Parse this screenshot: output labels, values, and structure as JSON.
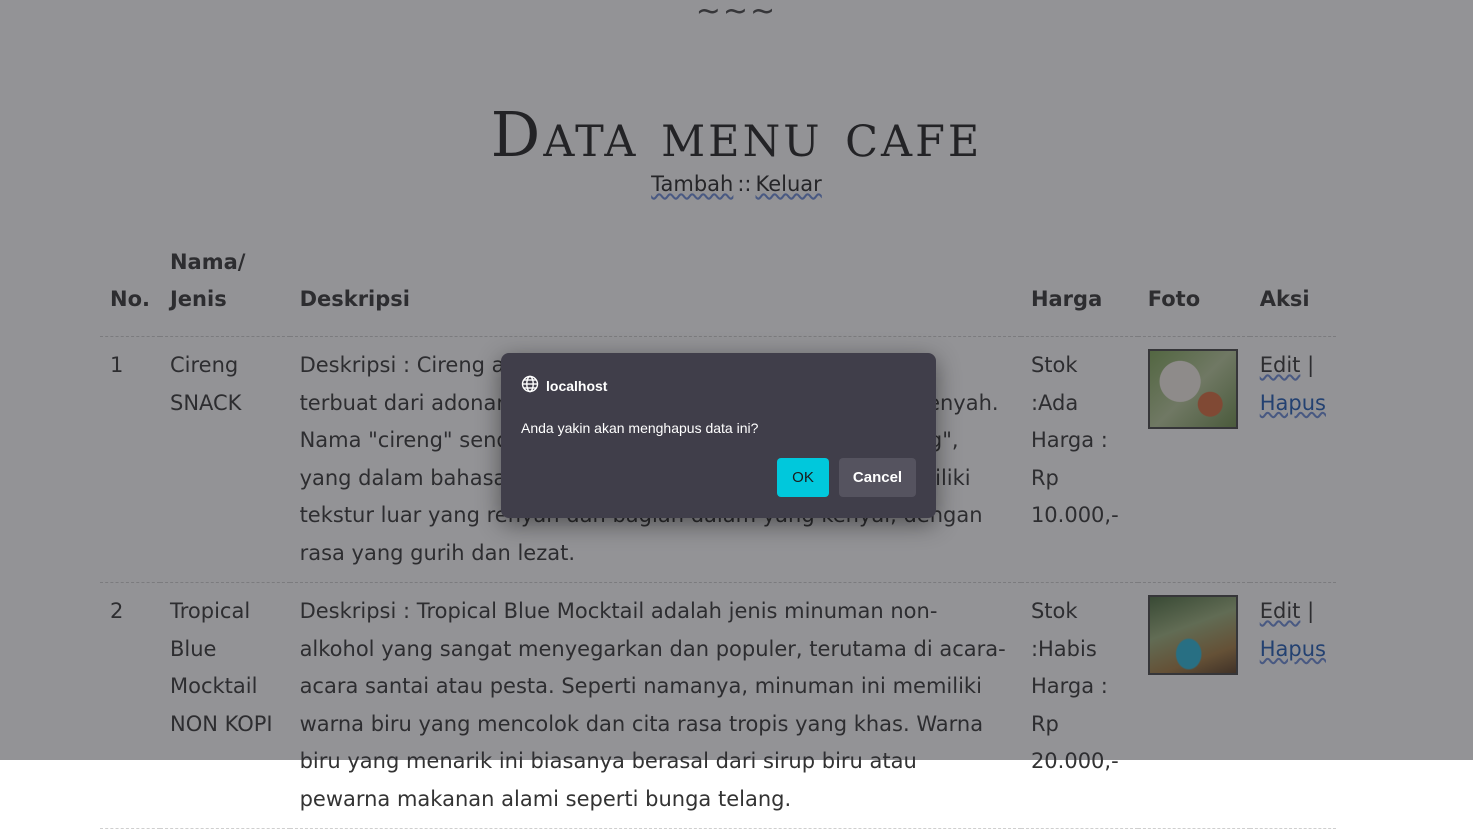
{
  "header": {
    "decoration": "~~~",
    "title": "Data menu cafe",
    "links": {
      "add": "Tambah",
      "separator": "::",
      "logout": "Keluar"
    }
  },
  "table": {
    "headers": {
      "no": "No.",
      "name": "Nama/ Jenis",
      "description": "Deskripsi",
      "price": "Harga",
      "photo": "Foto",
      "action": "Aksi"
    },
    "rows": [
      {
        "no": "1",
        "name": "Cireng",
        "type": "SNACK",
        "description": "Deskripsi : Cireng adalah makanan ringan khas Sunda yang terbuat dari adonan tepung tapioka yang digoreng hingga renyah. Nama \"cireng\" sendiri merupakan akronim dari \"aci digoreng\", yang dalam bahasa Sunda berarti aci digoreng. Cireng memiliki tekstur luar yang renyah dan bagian dalam yang kenyal, dengan rasa yang gurih dan lezat.",
        "stock": "Stok :Ada",
        "price": "Harga : Rp 10.000,-",
        "photo_icon": "cireng-photo",
        "edit": "Edit",
        "separator": "|",
        "delete": "Hapus"
      },
      {
        "no": "2",
        "name": "Tropical Blue Mocktail",
        "type": "NON KOPI",
        "description": "Deskripsi : Tropical Blue Mocktail adalah jenis minuman non-alkohol yang sangat menyegarkan dan populer, terutama di acara-acara santai atau pesta. Seperti namanya, minuman ini memiliki warna biru yang mencolok dan cita rasa tropis yang khas. Warna biru yang menarik ini biasanya berasal dari sirup biru atau pewarna makanan alami seperti bunga telang.",
        "stock": "Stok :Habis",
        "price": "Harga : Rp 20.000,-",
        "photo_icon": "mocktail-photo",
        "edit": "Edit",
        "separator": "|",
        "delete": "Hapus"
      }
    ]
  },
  "dialog": {
    "origin": "localhost",
    "message": "Anda yakin akan menghapus data ini?",
    "ok_label": "OK",
    "cancel_label": "Cancel",
    "ok_color": "#00c8dc",
    "background_color": "#403e4a"
  }
}
